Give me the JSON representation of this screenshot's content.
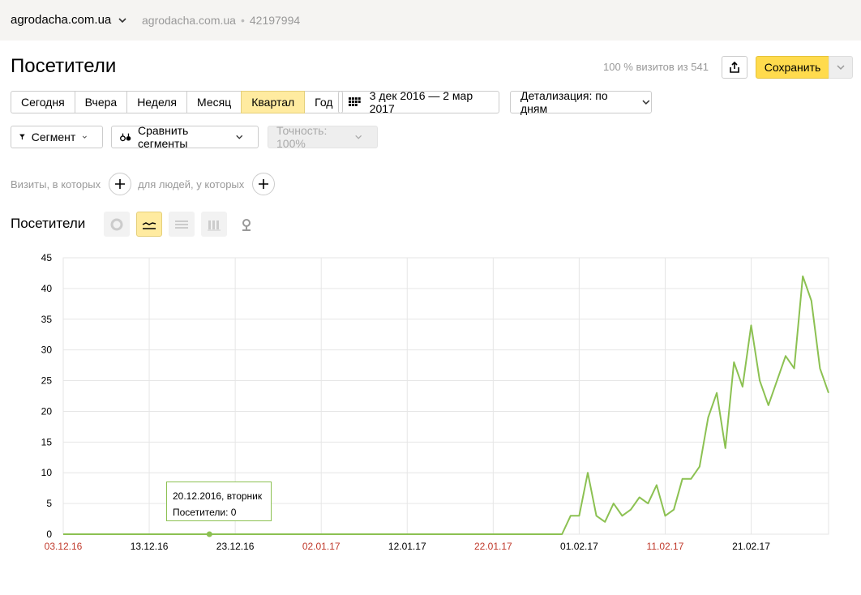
{
  "header": {
    "site_name": "agrodacha.com.ua",
    "site_secondary": "agrodacha.com.ua",
    "counter_id": "42197994",
    "separator": "•"
  },
  "page": {
    "title": "Посетители",
    "visits_info": "100 % визитов из 541",
    "save_label": "Сохранить"
  },
  "periods": [
    {
      "label": "Сегодня",
      "active": false
    },
    {
      "label": "Вчера",
      "active": false
    },
    {
      "label": "Неделя",
      "active": false
    },
    {
      "label": "Месяц",
      "active": false
    },
    {
      "label": "Квартал",
      "active": true
    },
    {
      "label": "Год",
      "active": false
    }
  ],
  "date_range": "3 дек 2016 — 2 мар 2017",
  "detail": "Детализация: по дням",
  "segments": {
    "segment_label": "Сегмент",
    "compare_label": "Сравнить сегменты",
    "accuracy_label": "Точность: 100%"
  },
  "filters": {
    "visits_label": "Визиты, в которых",
    "people_label": "для людей, у которых"
  },
  "chart_section": {
    "title": "Посетители",
    "types": [
      "pie-chart-icon",
      "line-chart-icon",
      "area-chart-icon",
      "bar-chart-icon",
      "map-icon"
    ],
    "active_type": "line-chart-icon"
  },
  "tooltip": {
    "date": "20.12.2016, вторник",
    "value": "Посетители: 0"
  },
  "colors": {
    "line": "#8cc152",
    "accent": "#ffdb4d",
    "weekend_label": "#c0392b"
  },
  "chart_data": {
    "type": "line",
    "title": "Посетители",
    "ylim": [
      0,
      45
    ],
    "yticks": [
      0,
      5,
      10,
      15,
      20,
      25,
      30,
      35,
      40,
      45
    ],
    "xticks": [
      {
        "label": "03.12.16",
        "index": 0,
        "weekend": true
      },
      {
        "label": "13.12.16",
        "index": 10,
        "weekend": false
      },
      {
        "label": "23.12.16",
        "index": 20,
        "weekend": false
      },
      {
        "label": "02.01.17",
        "index": 30,
        "weekend": true
      },
      {
        "label": "12.01.17",
        "index": 40,
        "weekend": false
      },
      {
        "label": "22.01.17",
        "index": 50,
        "weekend": true
      },
      {
        "label": "01.02.17",
        "index": 60,
        "weekend": false
      },
      {
        "label": "11.02.17",
        "index": 70,
        "weekend": true
      },
      {
        "label": "21.02.17",
        "index": 80,
        "weekend": false
      }
    ],
    "grid": true,
    "start_date": "03.12.16",
    "series": [
      {
        "values": [
          0,
          0,
          0,
          0,
          0,
          0,
          0,
          0,
          0,
          0,
          0,
          0,
          0,
          0,
          0,
          0,
          0,
          0,
          0,
          0,
          0,
          0,
          0,
          0,
          0,
          0,
          0,
          0,
          0,
          0,
          0,
          0,
          0,
          0,
          0,
          0,
          0,
          0,
          0,
          0,
          0,
          0,
          0,
          0,
          0,
          0,
          0,
          0,
          0,
          0,
          0,
          0,
          0,
          0,
          0,
          0,
          0,
          0,
          0,
          3,
          3,
          10,
          3,
          2,
          5,
          3,
          4,
          6,
          5,
          8,
          3,
          4,
          9,
          9,
          11,
          19,
          23,
          14,
          28,
          24,
          34,
          25,
          21,
          25,
          29,
          27,
          42,
          38,
          27,
          23
        ]
      }
    ],
    "highlight_index": 17
  }
}
